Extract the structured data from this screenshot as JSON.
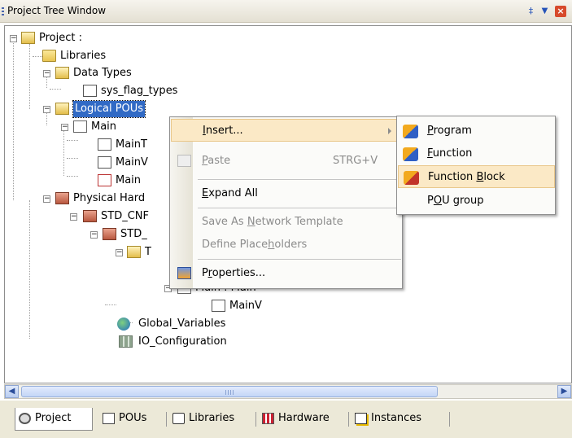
{
  "window": {
    "title": "Project Tree Window"
  },
  "tree": {
    "root": "Project :",
    "libraries": "Libraries",
    "data_types": "Data Types",
    "sys_flag_types": "sys_flag_types",
    "logical_pous": "Logical POUs",
    "main": "Main",
    "main_t": "MainT",
    "main_v": "MainV",
    "main_c": "Main",
    "physical_hardware": "Physical Hard",
    "std_cnf": "STD_CNF",
    "std_res": "STD_",
    "task": "T",
    "main_main": "Main : Main",
    "main_v2": "MainV",
    "global_variables": "Global_Variables",
    "io_configuration": "IO_Configuration"
  },
  "context_menu": {
    "insert": {
      "pre": "",
      "u": "I",
      "post": "nsert..."
    },
    "paste": {
      "pre": "",
      "u": "P",
      "post": "aste"
    },
    "paste_shortcut": "STRG+V",
    "expand_all": {
      "pre": "",
      "u": "E",
      "post": "xpand All"
    },
    "save_as_template": {
      "pre": "Save As ",
      "u": "N",
      "post": "etwork Template"
    },
    "define_placeholders": {
      "pre": "Define Place",
      "u": "h",
      "post": "olders"
    },
    "properties": {
      "pre": "P",
      "u": "r",
      "post": "operties..."
    }
  },
  "submenu": {
    "program": {
      "pre": "",
      "u": "P",
      "post": "rogram"
    },
    "function": {
      "pre": "",
      "u": "F",
      "post": "unction"
    },
    "function_block": {
      "pre": "Function ",
      "u": "B",
      "post": "lock"
    },
    "pou_group": {
      "pre": "P",
      "u": "O",
      "post": "U group"
    }
  },
  "tabs": [
    {
      "label": "Project"
    },
    {
      "label": "POUs"
    },
    {
      "label": "Libraries"
    },
    {
      "label": "Hardware"
    },
    {
      "label": "Instances"
    }
  ],
  "colors": {
    "selection": "#316ac5",
    "menu_highlight": "#fbe9c6",
    "titlebar": "#ece9d8"
  }
}
